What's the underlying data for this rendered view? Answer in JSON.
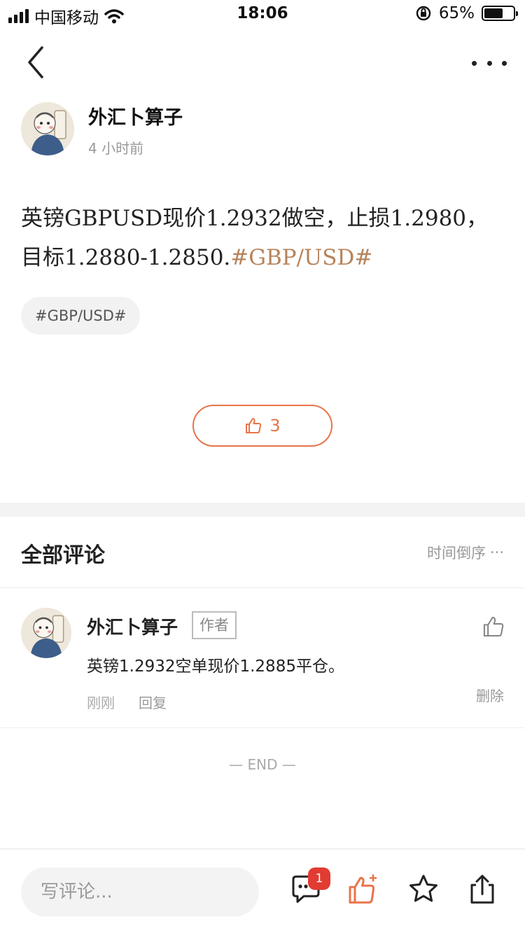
{
  "status_bar": {
    "carrier": "中国移动",
    "time": "18:06",
    "battery_percent": "65%",
    "battery_level": 0.65
  },
  "nav": {
    "back_icon": "chevron-left-icon",
    "more_icon": "more-dots-icon"
  },
  "post": {
    "author_name": "外汇卜算子",
    "time_ago": "4 小时前",
    "body_text": "英镑GBPUSD现价1.2932做空，止损1.2980，目标1.2880-1.2850.",
    "body_tag": "#GBP/USD#",
    "tag_chip": "#GBP/USD#",
    "like_count": "3"
  },
  "comments": {
    "title": "全部评论",
    "sort_label": "时间倒序",
    "items": [
      {
        "author": "外汇卜算子",
        "badge": "作者",
        "text": "英镑1.2932空单现价1.2885平仓。",
        "time": "刚刚",
        "reply_label": "回复",
        "delete_label": "删除"
      }
    ],
    "end_label": "— END —"
  },
  "bottom_bar": {
    "input_placeholder": "写评论...",
    "comment_badge": "1"
  },
  "colors": {
    "accent": "#e8744a",
    "tag_text": "#b7835b",
    "badge_red": "#e23b32"
  }
}
